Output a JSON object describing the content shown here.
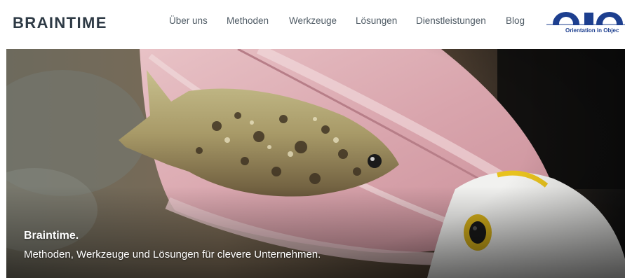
{
  "brand": {
    "name": "BRAINTIME"
  },
  "nav": {
    "items": [
      {
        "label": "Über uns"
      },
      {
        "label": "Methoden"
      },
      {
        "label": "Werkzeuge"
      },
      {
        "label": "Lösungen"
      },
      {
        "label": "Dienstleistungen"
      },
      {
        "label": "Blog"
      }
    ]
  },
  "partner_logo": {
    "text": "Orientation in Objec"
  },
  "hero": {
    "title": "Braintime.",
    "subtitle": "Methoden, Werkzeuge und Lösungen für clevere Unternehmen."
  },
  "colors": {
    "brand_text": "#2e3a45",
    "nav_text": "#4e5a64",
    "logo_blue": "#1d3f8f",
    "hero_text": "#ffffff"
  }
}
